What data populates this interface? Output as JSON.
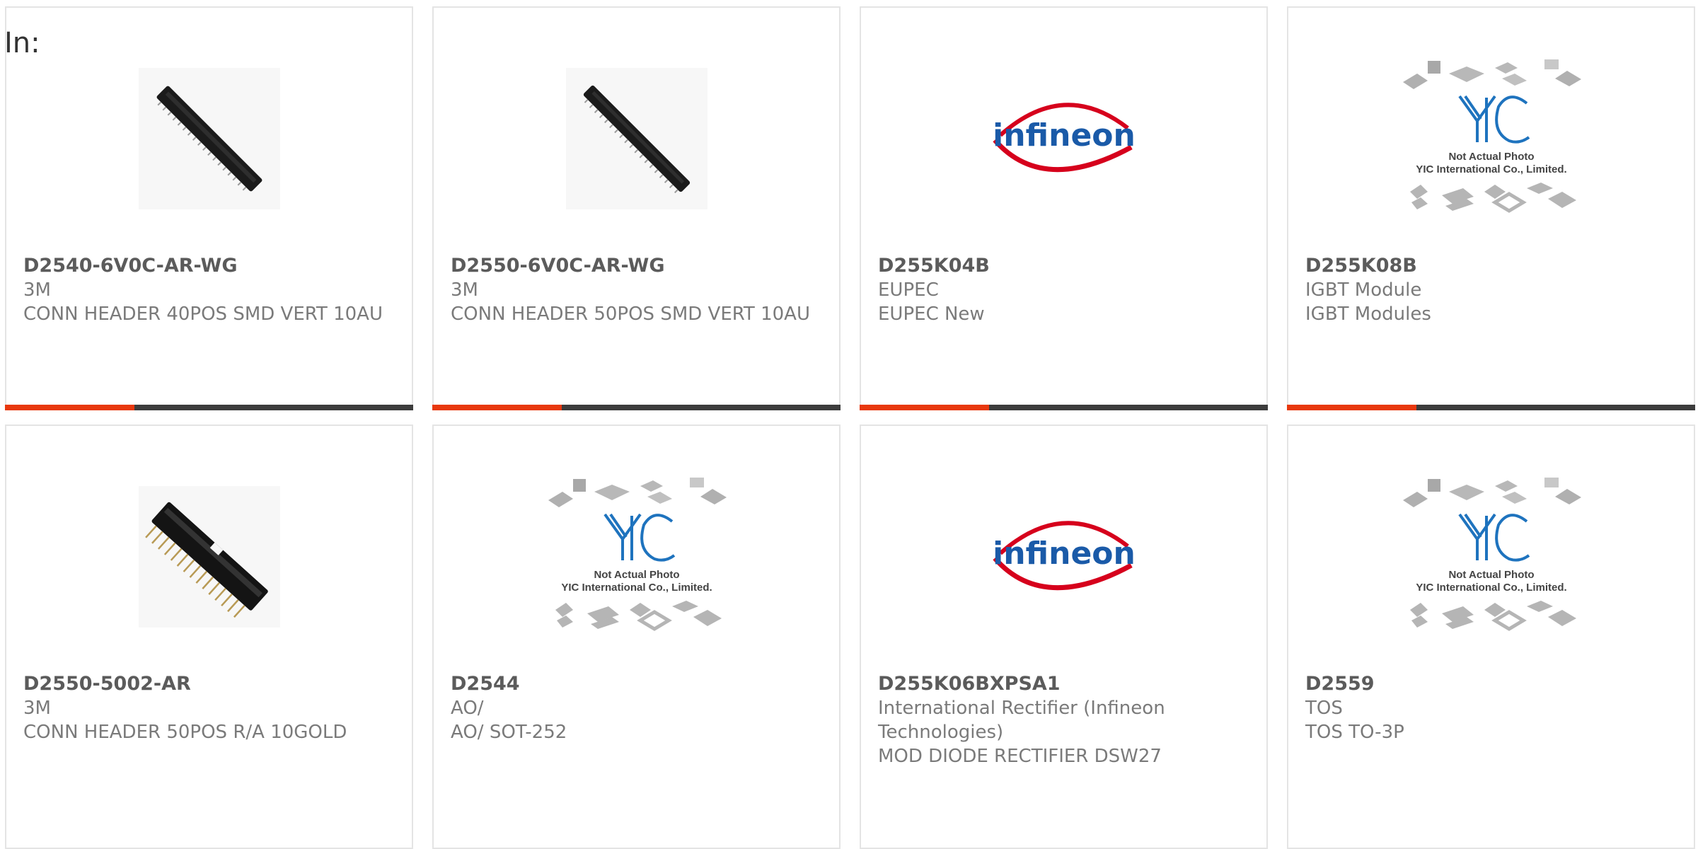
{
  "page": {
    "label": "In:"
  },
  "colors": {
    "accent": "#e8380d",
    "bar": "#3c3c3c",
    "infineon_red": "#d6001c",
    "infineon_blue": "#1a5aa8",
    "yic_blue": "#1e73be"
  },
  "products": [
    {
      "part": "D2540-6V0C-AR-WG",
      "brand": "3M",
      "desc": "CONN HEADER 40POS SMD VERT 10AU",
      "image": "connector-straight"
    },
    {
      "part": "D2550-6V0C-AR-WG",
      "brand": "3M",
      "desc": "CONN HEADER 50POS SMD VERT 10AU",
      "image": "connector-straight"
    },
    {
      "part": "D255K04B",
      "brand": "EUPEC",
      "desc": "EUPEC New",
      "image": "infineon-logo"
    },
    {
      "part": "D255K08B",
      "brand": "IGBT Module",
      "desc": "IGBT Modules",
      "image": "yic-placeholder"
    },
    {
      "part": "D2550-5002-AR",
      "brand": "3M",
      "desc": "CONN HEADER 50POS R/A 10GOLD",
      "image": "connector-ra"
    },
    {
      "part": "D2544",
      "brand": "AO/",
      "desc": "AO/ SOT-252",
      "image": "yic-placeholder"
    },
    {
      "part": "D255K06BXPSA1",
      "brand": "International Rectifier (Infineon Technologies)",
      "desc": "MOD DIODE RECTIFIER DSW27",
      "image": "infineon-logo"
    },
    {
      "part": "D2559",
      "brand": "TOS",
      "desc": "TOS TO-3P",
      "image": "yic-placeholder"
    }
  ],
  "logos": {
    "infineon": "infineon",
    "yic_mark": "YIC",
    "yic_line1": "Not Actual Photo",
    "yic_line2": "YIC International Co., Limited."
  }
}
